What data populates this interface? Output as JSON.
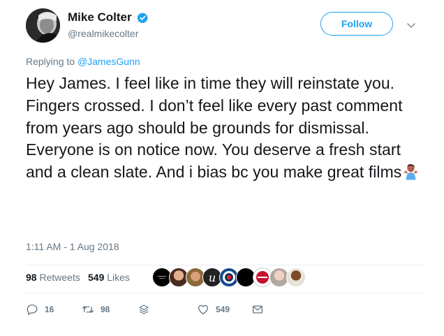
{
  "user": {
    "display_name": "Mike Colter",
    "handle": "@realmikecolter",
    "verified_icon": "verified-badge-icon"
  },
  "follow": {
    "label": "Follow"
  },
  "reply": {
    "prefix": "Replying to",
    "target": "@JamesGunn"
  },
  "tweet": {
    "text": "Hey James. I feel like in time they will reinstate you. Fingers crossed. I don’t feel like every past comment from years ago should be grounds for dismissal. Everyone is on notice now. You deserve a fresh start and a clean slate. And i bias bc you make great films",
    "emoji": "person-shrugging-emoji",
    "timestamp": "1:11 AM - 1 Aug 2018"
  },
  "stats": {
    "retweets_count": "98",
    "retweets_label": "Retweets",
    "likes_count": "549",
    "likes_label": "Likes"
  },
  "actions": {
    "reply_count": "16",
    "retweet_count": "98",
    "like_count": "549"
  },
  "colors": {
    "accent": "#1da1f2",
    "secondary_text": "#657786",
    "primary_text": "#14171a",
    "divider": "#e6ecf0"
  }
}
